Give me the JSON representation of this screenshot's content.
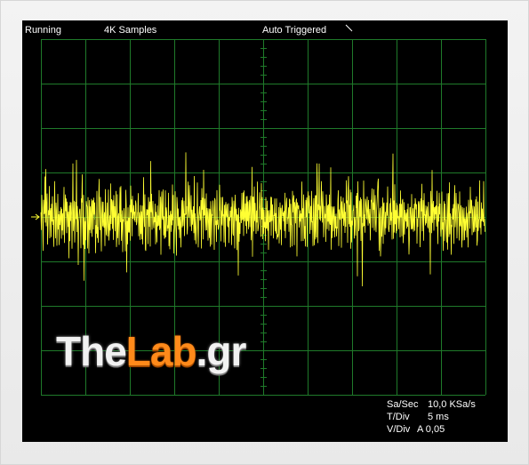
{
  "status": {
    "run_state": "Running",
    "samples": "4K Samples",
    "trigger_mode": "Auto Triggered"
  },
  "readouts": {
    "sample_rate_label": "Sa/Sec",
    "sample_rate_value": "10,0 KSa/s",
    "time_div_label": "T/Div",
    "time_div_value": "5 ms",
    "volt_div_label": "V/Div",
    "volt_div_value": "A 0,05"
  },
  "watermark": {
    "part1": "The",
    "part2": "Lab",
    "part3": ".gr"
  },
  "colors": {
    "screen_background": "#000000",
    "grid": "#1f7a2a",
    "trace": "#ffff33",
    "text": "#ffffff",
    "brand_orange": "#ff8a1a"
  },
  "chart_data": {
    "type": "line",
    "title": "",
    "xlabel": "",
    "ylabel": "",
    "grid": true,
    "x_divisions": 10,
    "y_divisions": 8,
    "xlim": [
      0,
      50
    ],
    "ylim": [
      -0.2,
      0.2
    ],
    "series": [
      {
        "values": [
          0.002,
          -0.018,
          0.021,
          -0.004,
          0.009,
          -0.031,
          0.015,
          0.003,
          -0.012,
          0.028,
          -0.007,
          0.011,
          -0.022,
          0.006,
          0.017,
          -0.026,
          0.001,
          0.013,
          -0.009,
          0.024,
          -0.015,
          0.004,
          0.019,
          -0.029,
          0.008,
          -0.002,
          0.026,
          -0.011,
          0.005,
          -0.021,
          0.014,
          0.031,
          -0.006,
          -0.017,
          0.022,
          0.001,
          -0.024,
          0.01,
          0.018,
          -0.013,
          0.003,
          -0.027,
          0.016,
          0.007,
          -0.008,
          0.025,
          -0.019,
          0.012,
          -0.003,
          0.02,
          -0.014,
          0.006,
          0.029,
          -0.023,
          -0.001,
          0.017,
          -0.01,
          0.023,
          -0.016,
          0.004,
          0.011,
          -0.028,
          0.019,
          -0.005,
          0.008,
          -0.02,
          0.027,
          -0.009,
          0.002,
          0.015,
          -0.025,
          0.01,
          0.021,
          -0.012,
          -0.004,
          0.018,
          -0.03,
          0.006,
          0.013,
          -0.007,
          0.024,
          -0.018,
          0.001,
          0.016,
          -0.022,
          0.009,
          -0.011,
          0.028,
          -0.002,
          0.005,
          -0.026,
          0.02,
          0.012,
          -0.015,
          0.007,
          -0.019,
          0.03,
          -0.006,
          0.014,
          -0.023
        ]
      }
    ]
  }
}
